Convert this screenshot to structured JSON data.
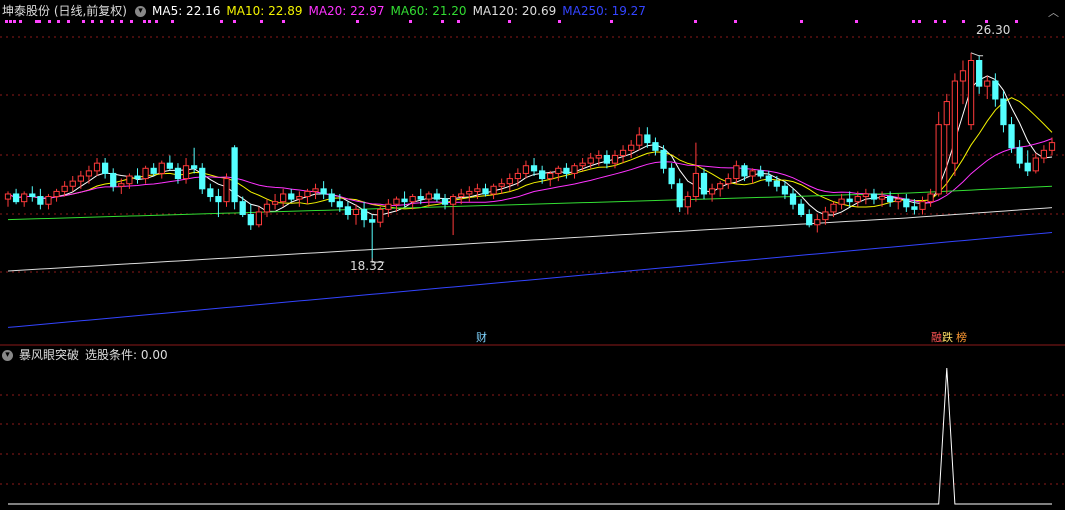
{
  "header": {
    "title": "坤泰股份 (日线,前复权)",
    "ma": [
      {
        "label": "MA5: 22.16",
        "color": "#ffffff"
      },
      {
        "label": "MA10: 22.89",
        "color": "#f4f400"
      },
      {
        "label": "MA20: 22.97",
        "color": "#ff33ff"
      },
      {
        "label": "MA60: 21.20",
        "color": "#33dd33"
      },
      {
        "label": "MA120: 20.69",
        "color": "#dddddd"
      },
      {
        "label": "MA250: 19.27",
        "color": "#3344ff"
      }
    ]
  },
  "annotations": {
    "high": "26.30",
    "low": "18.32"
  },
  "markers": [
    {
      "text": "财",
      "color": "#7fd4ff"
    },
    {
      "text": "融",
      "color": "#ff5555"
    },
    {
      "text": "跌",
      "color": "#ffe066"
    },
    {
      "text": "榜",
      "color": "#ff9933"
    }
  ],
  "indicator": {
    "name": "暴风眼突破",
    "condition": "选股条件: 0.00"
  },
  "colors": {
    "up": "#ff3b3b",
    "down": "#54ffff",
    "grid": "#8b1a1a",
    "dots": "#ff44ff"
  },
  "chart_data": [
    {
      "type": "candlestick",
      "title": "坤泰股份 (日线,前复权)",
      "ylim": [
        15.5,
        27.5
      ],
      "annotated_high": 26.3,
      "annotated_low": 18.32,
      "candles": [
        {
          "o": 20.6,
          "h": 20.9,
          "l": 20.3,
          "c": 20.8
        },
        {
          "o": 20.8,
          "h": 21.0,
          "l": 20.4,
          "c": 20.5
        },
        {
          "o": 20.5,
          "h": 20.9,
          "l": 20.3,
          "c": 20.8
        },
        {
          "o": 20.8,
          "h": 21.1,
          "l": 20.5,
          "c": 20.7
        },
        {
          "o": 20.7,
          "h": 21.0,
          "l": 20.2,
          "c": 20.4
        },
        {
          "o": 20.4,
          "h": 20.8,
          "l": 20.2,
          "c": 20.7
        },
        {
          "o": 20.7,
          "h": 21.0,
          "l": 20.5,
          "c": 20.9
        },
        {
          "o": 20.9,
          "h": 21.3,
          "l": 20.7,
          "c": 21.1
        },
        {
          "o": 21.1,
          "h": 21.5,
          "l": 20.9,
          "c": 21.3
        },
        {
          "o": 21.3,
          "h": 21.7,
          "l": 21.0,
          "c": 21.5
        },
        {
          "o": 21.5,
          "h": 21.9,
          "l": 21.2,
          "c": 21.7
        },
        {
          "o": 21.7,
          "h": 22.2,
          "l": 21.5,
          "c": 22.0
        },
        {
          "o": 22.0,
          "h": 22.2,
          "l": 21.4,
          "c": 21.6
        },
        {
          "o": 21.6,
          "h": 21.8,
          "l": 20.9,
          "c": 21.1
        },
        {
          "o": 21.1,
          "h": 21.4,
          "l": 20.8,
          "c": 21.2
        },
        {
          "o": 21.2,
          "h": 21.6,
          "l": 21.0,
          "c": 21.5
        },
        {
          "o": 21.5,
          "h": 21.8,
          "l": 21.2,
          "c": 21.4
        },
        {
          "o": 21.4,
          "h": 21.9,
          "l": 21.2,
          "c": 21.8
        },
        {
          "o": 21.8,
          "h": 22.0,
          "l": 21.5,
          "c": 21.6
        },
        {
          "o": 21.6,
          "h": 22.1,
          "l": 21.4,
          "c": 22.0
        },
        {
          "o": 22.0,
          "h": 22.3,
          "l": 21.7,
          "c": 21.8
        },
        {
          "o": 21.8,
          "h": 22.0,
          "l": 21.2,
          "c": 21.4
        },
        {
          "o": 21.4,
          "h": 22.2,
          "l": 21.2,
          "c": 21.9
        },
        {
          "o": 21.9,
          "h": 22.6,
          "l": 21.6,
          "c": 21.8
        },
        {
          "o": 21.8,
          "h": 22.0,
          "l": 20.8,
          "c": 21.0
        },
        {
          "o": 21.0,
          "h": 21.2,
          "l": 20.5,
          "c": 20.7
        },
        {
          "o": 20.7,
          "h": 21.0,
          "l": 19.9,
          "c": 20.5
        },
        {
          "o": 20.5,
          "h": 21.6,
          "l": 20.3,
          "c": 21.4
        },
        {
          "o": 22.6,
          "h": 22.7,
          "l": 20.2,
          "c": 20.5
        },
        {
          "o": 20.5,
          "h": 20.7,
          "l": 19.9,
          "c": 20.0
        },
        {
          "o": 20.0,
          "h": 20.4,
          "l": 19.4,
          "c": 19.6
        },
        {
          "o": 19.6,
          "h": 20.3,
          "l": 19.5,
          "c": 20.1
        },
        {
          "o": 20.1,
          "h": 20.6,
          "l": 19.9,
          "c": 20.4
        },
        {
          "o": 20.4,
          "h": 20.8,
          "l": 20.2,
          "c": 20.5
        },
        {
          "o": 20.5,
          "h": 21.0,
          "l": 20.3,
          "c": 20.8
        },
        {
          "o": 20.8,
          "h": 21.0,
          "l": 20.5,
          "c": 20.6
        },
        {
          "o": 20.6,
          "h": 20.9,
          "l": 20.3,
          "c": 20.7
        },
        {
          "o": 20.7,
          "h": 21.0,
          "l": 20.4,
          "c": 20.9
        },
        {
          "o": 20.9,
          "h": 21.2,
          "l": 20.6,
          "c": 21.0
        },
        {
          "o": 21.0,
          "h": 21.3,
          "l": 20.6,
          "c": 20.8
        },
        {
          "o": 20.8,
          "h": 21.0,
          "l": 20.3,
          "c": 20.5
        },
        {
          "o": 20.5,
          "h": 20.8,
          "l": 20.1,
          "c": 20.3
        },
        {
          "o": 20.3,
          "h": 20.5,
          "l": 19.8,
          "c": 20.0
        },
        {
          "o": 20.0,
          "h": 20.4,
          "l": 19.6,
          "c": 20.2
        },
        {
          "o": 20.2,
          "h": 20.5,
          "l": 19.5,
          "c": 19.8
        },
        {
          "o": 19.8,
          "h": 20.0,
          "l": 18.3,
          "c": 19.7
        },
        {
          "o": 19.7,
          "h": 20.3,
          "l": 19.5,
          "c": 20.2
        },
        {
          "o": 20.2,
          "h": 20.6,
          "l": 19.9,
          "c": 20.4
        },
        {
          "o": 20.4,
          "h": 20.7,
          "l": 20.1,
          "c": 20.6
        },
        {
          "o": 20.6,
          "h": 20.9,
          "l": 20.3,
          "c": 20.5
        },
        {
          "o": 20.5,
          "h": 20.8,
          "l": 20.2,
          "c": 20.7
        },
        {
          "o": 20.7,
          "h": 21.0,
          "l": 20.4,
          "c": 20.6
        },
        {
          "o": 20.6,
          "h": 20.9,
          "l": 20.3,
          "c": 20.8
        },
        {
          "o": 20.8,
          "h": 21.0,
          "l": 20.5,
          "c": 20.6
        },
        {
          "o": 20.6,
          "h": 20.8,
          "l": 20.2,
          "c": 20.4
        },
        {
          "o": 20.4,
          "h": 20.8,
          "l": 19.2,
          "c": 20.7
        },
        {
          "o": 20.7,
          "h": 21.0,
          "l": 20.4,
          "c": 20.8
        },
        {
          "o": 20.8,
          "h": 21.1,
          "l": 20.5,
          "c": 20.9
        },
        {
          "o": 20.9,
          "h": 21.2,
          "l": 20.6,
          "c": 21.0
        },
        {
          "o": 21.0,
          "h": 21.2,
          "l": 20.7,
          "c": 20.8
        },
        {
          "o": 20.8,
          "h": 21.2,
          "l": 20.6,
          "c": 21.1
        },
        {
          "o": 21.1,
          "h": 21.4,
          "l": 20.8,
          "c": 21.2
        },
        {
          "o": 21.2,
          "h": 21.6,
          "l": 20.9,
          "c": 21.4
        },
        {
          "o": 21.4,
          "h": 21.8,
          "l": 21.1,
          "c": 21.6
        },
        {
          "o": 21.6,
          "h": 22.1,
          "l": 21.4,
          "c": 21.9
        },
        {
          "o": 21.9,
          "h": 22.2,
          "l": 21.5,
          "c": 21.7
        },
        {
          "o": 21.7,
          "h": 21.9,
          "l": 21.2,
          "c": 21.4
        },
        {
          "o": 21.4,
          "h": 21.7,
          "l": 21.1,
          "c": 21.6
        },
        {
          "o": 21.6,
          "h": 21.9,
          "l": 21.3,
          "c": 21.8
        },
        {
          "o": 21.8,
          "h": 22.0,
          "l": 21.4,
          "c": 21.6
        },
        {
          "o": 21.6,
          "h": 22.0,
          "l": 21.4,
          "c": 21.9
        },
        {
          "o": 21.9,
          "h": 22.2,
          "l": 21.7,
          "c": 22.0
        },
        {
          "o": 22.0,
          "h": 22.4,
          "l": 21.8,
          "c": 22.2
        },
        {
          "o": 22.2,
          "h": 22.5,
          "l": 21.9,
          "c": 22.3
        },
        {
          "o": 22.3,
          "h": 22.5,
          "l": 21.8,
          "c": 22.0
        },
        {
          "o": 22.0,
          "h": 22.5,
          "l": 21.8,
          "c": 22.3
        },
        {
          "o": 22.3,
          "h": 22.7,
          "l": 22.0,
          "c": 22.5
        },
        {
          "o": 22.5,
          "h": 22.9,
          "l": 22.2,
          "c": 22.7
        },
        {
          "o": 22.7,
          "h": 23.4,
          "l": 22.5,
          "c": 23.1
        },
        {
          "o": 23.1,
          "h": 23.4,
          "l": 22.6,
          "c": 22.8
        },
        {
          "o": 22.8,
          "h": 23.0,
          "l": 22.3,
          "c": 22.5
        },
        {
          "o": 22.5,
          "h": 22.7,
          "l": 21.6,
          "c": 21.8
        },
        {
          "o": 21.8,
          "h": 22.0,
          "l": 21.0,
          "c": 21.2
        },
        {
          "o": 21.2,
          "h": 21.4,
          "l": 20.1,
          "c": 20.3
        },
        {
          "o": 20.3,
          "h": 20.9,
          "l": 20.0,
          "c": 20.7
        },
        {
          "o": 20.7,
          "h": 22.8,
          "l": 20.5,
          "c": 21.6
        },
        {
          "o": 21.6,
          "h": 21.8,
          "l": 20.6,
          "c": 20.8
        },
        {
          "o": 20.8,
          "h": 21.2,
          "l": 20.5,
          "c": 21.0
        },
        {
          "o": 21.0,
          "h": 21.3,
          "l": 20.7,
          "c": 21.2
        },
        {
          "o": 21.2,
          "h": 21.6,
          "l": 21.0,
          "c": 21.4
        },
        {
          "o": 21.4,
          "h": 22.1,
          "l": 21.2,
          "c": 21.9
        },
        {
          "o": 21.9,
          "h": 22.0,
          "l": 21.3,
          "c": 21.5
        },
        {
          "o": 21.5,
          "h": 21.8,
          "l": 21.2,
          "c": 21.7
        },
        {
          "o": 21.7,
          "h": 21.9,
          "l": 21.4,
          "c": 21.5
        },
        {
          "o": 21.5,
          "h": 21.7,
          "l": 21.1,
          "c": 21.3
        },
        {
          "o": 21.3,
          "h": 21.5,
          "l": 20.9,
          "c": 21.1
        },
        {
          "o": 21.1,
          "h": 21.3,
          "l": 20.6,
          "c": 20.8
        },
        {
          "o": 20.8,
          "h": 21.0,
          "l": 20.2,
          "c": 20.4
        },
        {
          "o": 20.4,
          "h": 20.6,
          "l": 19.9,
          "c": 20.0
        },
        {
          "o": 20.0,
          "h": 20.2,
          "l": 19.5,
          "c": 19.6
        },
        {
          "o": 19.6,
          "h": 20.0,
          "l": 19.3,
          "c": 19.8
        },
        {
          "o": 19.8,
          "h": 20.3,
          "l": 19.6,
          "c": 20.1
        },
        {
          "o": 20.1,
          "h": 20.5,
          "l": 19.9,
          "c": 20.4
        },
        {
          "o": 20.4,
          "h": 20.8,
          "l": 20.2,
          "c": 20.6
        },
        {
          "o": 20.6,
          "h": 20.9,
          "l": 20.3,
          "c": 20.5
        },
        {
          "o": 20.5,
          "h": 20.9,
          "l": 20.3,
          "c": 20.7
        },
        {
          "o": 20.7,
          "h": 21.0,
          "l": 20.4,
          "c": 20.8
        },
        {
          "o": 20.8,
          "h": 21.0,
          "l": 20.4,
          "c": 20.6
        },
        {
          "o": 20.6,
          "h": 20.9,
          "l": 20.3,
          "c": 20.7
        },
        {
          "o": 20.7,
          "h": 20.9,
          "l": 20.3,
          "c": 20.5
        },
        {
          "o": 20.5,
          "h": 20.8,
          "l": 20.2,
          "c": 20.6
        },
        {
          "o": 20.6,
          "h": 20.8,
          "l": 20.1,
          "c": 20.3
        },
        {
          "o": 20.3,
          "h": 20.6,
          "l": 20.0,
          "c": 20.2
        },
        {
          "o": 20.2,
          "h": 20.7,
          "l": 20.0,
          "c": 20.5
        },
        {
          "o": 20.5,
          "h": 21.0,
          "l": 20.3,
          "c": 20.8
        },
        {
          "o": 20.8,
          "h": 24.0,
          "l": 20.7,
          "c": 23.5
        },
        {
          "o": 23.5,
          "h": 24.7,
          "l": 20.8,
          "c": 24.4
        },
        {
          "o": 22.0,
          "h": 25.5,
          "l": 21.5,
          "c": 25.2
        },
        {
          "o": 25.2,
          "h": 26.0,
          "l": 24.3,
          "c": 25.6
        },
        {
          "o": 23.5,
          "h": 26.3,
          "l": 23.3,
          "c": 26.0
        },
        {
          "o": 26.0,
          "h": 26.2,
          "l": 24.7,
          "c": 25.0
        },
        {
          "o": 25.0,
          "h": 25.4,
          "l": 24.5,
          "c": 25.2
        },
        {
          "o": 25.2,
          "h": 25.5,
          "l": 24.2,
          "c": 24.5
        },
        {
          "o": 24.5,
          "h": 24.8,
          "l": 23.2,
          "c": 23.5
        },
        {
          "o": 23.5,
          "h": 23.8,
          "l": 22.4,
          "c": 22.6
        },
        {
          "o": 22.6,
          "h": 22.9,
          "l": 21.8,
          "c": 22.0
        },
        {
          "o": 22.0,
          "h": 22.5,
          "l": 21.5,
          "c": 21.7
        },
        {
          "o": 21.7,
          "h": 22.4,
          "l": 21.6,
          "c": 22.2
        },
        {
          "o": 22.2,
          "h": 22.7,
          "l": 22.0,
          "c": 22.5
        },
        {
          "o": 22.5,
          "h": 23.0,
          "l": 22.3,
          "c": 22.8
        }
      ]
    },
    {
      "type": "line",
      "title": "暴风眼突破",
      "ylim": [
        0,
        1
      ],
      "spike_index": 116,
      "baseline": 0,
      "peak": 1
    }
  ]
}
